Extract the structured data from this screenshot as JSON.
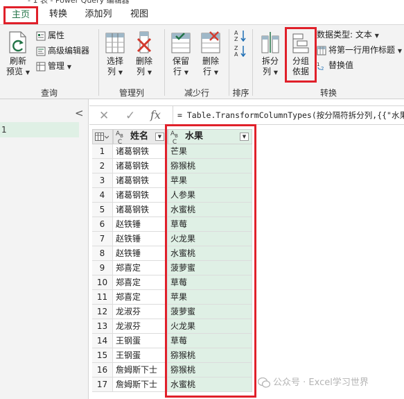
{
  "window": {
    "title": "- 1 表 - Power Query 编辑器"
  },
  "tabs": [
    {
      "label": "主页",
      "active": true
    },
    {
      "label": "转换",
      "active": false
    },
    {
      "label": "添加列",
      "active": false
    },
    {
      "label": "视图",
      "active": false
    }
  ],
  "ribbon": {
    "query": {
      "refresh": {
        "line1": "刷新",
        "line2": "预览"
      },
      "properties": "属性",
      "advanced_editor": "高级编辑器",
      "manage": "管理",
      "group_label": "查询"
    },
    "manage_columns": {
      "choose": {
        "line1": "选择",
        "line2": "列"
      },
      "remove": {
        "line1": "删除",
        "line2": "列"
      },
      "group_label": "管理列"
    },
    "reduce_rows": {
      "keep": {
        "line1": "保留",
        "line2": "行"
      },
      "remove": {
        "line1": "删除",
        "line2": "行"
      },
      "group_label": "减少行"
    },
    "sort": {
      "group_label": "排序"
    },
    "transform": {
      "split": {
        "line1": "拆分",
        "line2": "列"
      },
      "group_by": {
        "line1": "分组",
        "line2": "依据"
      },
      "data_type": "数据类型: 文本",
      "use_first_row": "将第一行用作标题",
      "replace_values": "替换值",
      "group_label": "转换"
    }
  },
  "left_pane": {
    "query_item": "1"
  },
  "formula_bar": {
    "fx": "fx",
    "formula": "= Table.TransformColumnTypes(按分隔符拆分列,{{\"水果\""
  },
  "table": {
    "columns": [
      "姓名",
      "水果"
    ],
    "column_type_label": "ABC",
    "rows": [
      [
        "1",
        "诸葛钢铁",
        "芒果"
      ],
      [
        "2",
        "诸葛钢铁",
        "猕猴桃"
      ],
      [
        "3",
        "诸葛钢铁",
        "苹果"
      ],
      [
        "4",
        "诸葛钢铁",
        "人参果"
      ],
      [
        "5",
        "诸葛钢铁",
        "水蜜桃"
      ],
      [
        "6",
        "赵铁锤",
        "草莓"
      ],
      [
        "7",
        "赵铁锤",
        "火龙果"
      ],
      [
        "8",
        "赵铁锤",
        "水蜜桃"
      ],
      [
        "9",
        "郑喜定",
        "菠萝蜜"
      ],
      [
        "10",
        "郑喜定",
        "草莓"
      ],
      [
        "11",
        "郑喜定",
        "苹果"
      ],
      [
        "12",
        "龙淑芬",
        "菠萝蜜"
      ],
      [
        "13",
        "龙淑芬",
        "火龙果"
      ],
      [
        "14",
        "王钢蛋",
        "草莓"
      ],
      [
        "15",
        "王钢蛋",
        "猕猴桃"
      ],
      [
        "16",
        "詹姆斯下士",
        "猕猴桃"
      ],
      [
        "17",
        "詹姆斯下士",
        "水蜜桃"
      ]
    ]
  },
  "watermark": "公众号 · Excel学习世界",
  "colors": {
    "accent_green": "#217346",
    "highlight_red": "#e0202a",
    "selected_column": "#dff0e5"
  }
}
